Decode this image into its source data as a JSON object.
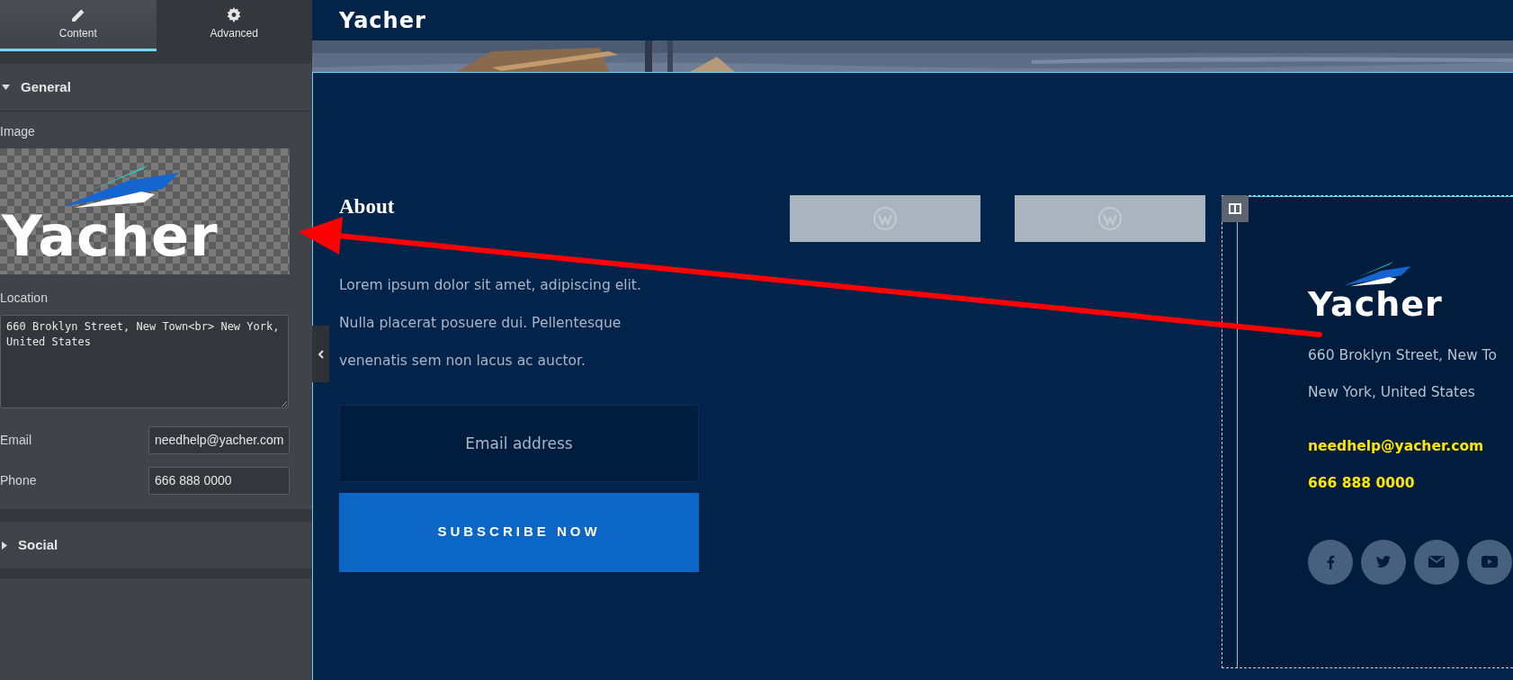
{
  "panel": {
    "tabs": [
      {
        "label": "Content",
        "selected": true,
        "kind": "pencil"
      },
      {
        "label": "Advanced",
        "selected": false,
        "kind": "gear"
      }
    ],
    "sections": [
      {
        "title": "General",
        "expanded": true
      },
      {
        "title": "Social",
        "expanded": false
      }
    ],
    "image_label": "Image",
    "image_logo": "Yacher",
    "location_label": "Location",
    "location_value": "660 Broklyn Street, New Town<br> New York, United States",
    "email_label": "Email",
    "email_value": "needhelp@yacher.com",
    "phone_label": "Phone",
    "phone_value": "666 888 0000"
  },
  "page": {
    "header_logo": "Yacher",
    "about_title": "About",
    "about_lines": [
      "Lorem ipsum dolor sit amet, adipiscing elit.",
      "Nulla placerat posuere dui. Pellentesque",
      "venenatis sem non lacus ac auctor."
    ],
    "email_placeholder": "Email address",
    "subscribe_button": "SUBSCRIBE NOW",
    "contact": {
      "logo": "Yacher",
      "address_lines": [
        "660 Broklyn Street, New To",
        "New York, United States"
      ],
      "email": "needhelp@yacher.com",
      "phone": "666 888 0000",
      "socials": [
        {
          "kind": "facebook"
        },
        {
          "kind": "twitter"
        },
        {
          "kind": "email"
        },
        {
          "kind": "youtube"
        }
      ]
    }
  }
}
